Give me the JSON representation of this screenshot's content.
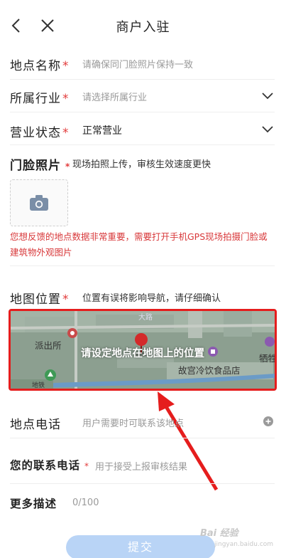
{
  "header": {
    "title": "商户入驻",
    "back_icon": "chevron-left-icon",
    "close_icon": "close-icon"
  },
  "form": {
    "location_name": {
      "label": "地点名称",
      "required_mark": "*",
      "placeholder": "请确保同门脸照片保持一致"
    },
    "industry": {
      "label": "所属行业",
      "required_mark": "*",
      "placeholder": "请选择所属行业"
    },
    "business_status": {
      "label": "营业状态",
      "required_mark": "*",
      "value": "正常营业"
    },
    "storefront_photo": {
      "label": "门脸照片",
      "required_mark": "*",
      "hint": "现场拍照上传，审核生效速度更快",
      "warning": "您想反馈的地点数据非常重要，需要打开手机GPS现场拍摄门脸或建筑物外观图片"
    },
    "map_location": {
      "label": "地图位置",
      "required_mark": "*",
      "hint": "位置有误将影响导航，请仔细确认",
      "overlay_text": "请设定地点在地图上的位置",
      "poi_police": "派出所",
      "poi_food": "故宫冷饮食品店",
      "poi_right": "牺牲",
      "poi_bottom": "地铁",
      "poi_top": "大路"
    },
    "location_phone": {
      "label": "地点电话",
      "placeholder": "用户需要时可联系该地点"
    },
    "contact_phone": {
      "label": "您的联系电话",
      "required_mark": "*",
      "placeholder": "用于接受上报审核结果"
    },
    "more_description": {
      "label": "更多描述",
      "counter": "0/100"
    }
  },
  "submit_label": "提交",
  "watermark": {
    "text": "Bai 经验",
    "sub": "jingyan.baidu.com"
  },
  "colors": {
    "accent_red": "#e51d1d",
    "required_red": "#e23b3b",
    "submit_blue": "#b9d4f6"
  }
}
